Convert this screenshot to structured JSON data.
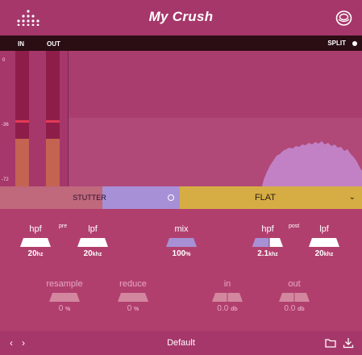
{
  "header": {
    "title": "My Crush",
    "logo_icon": "dots-logo-icon",
    "preset_icon": "preset-menu-icon"
  },
  "meters": {
    "in_label": "IN",
    "out_label": "OUT",
    "scale": [
      "0",
      "-36",
      "-72"
    ],
    "in_level": 0.35,
    "out_level": 0.35,
    "peak_level": 0.47
  },
  "split": {
    "label": "SPLIT"
  },
  "stutter": {
    "label": "STUTTER",
    "selected_fraction": 0.43
  },
  "filter_mode": {
    "label": "FLAT",
    "chevron": "⌄"
  },
  "pre": {
    "tag": "pre",
    "hpf": {
      "label": "hpf",
      "value": "20",
      "unit": "hz"
    },
    "lpf": {
      "label": "lpf",
      "value": "20",
      "unit": "khz"
    }
  },
  "mix": {
    "label": "mix",
    "value": "100",
    "unit": "%"
  },
  "post": {
    "tag": "post",
    "hpf": {
      "label": "hpf",
      "value": "2.1",
      "unit": "khz"
    },
    "lpf": {
      "label": "lpf",
      "value": "20",
      "unit": "khz"
    }
  },
  "resample": {
    "label": "resample",
    "value": "0",
    "unit": "%"
  },
  "reduce": {
    "label": "reduce",
    "value": "0",
    "unit": "%"
  },
  "in_gain": {
    "label": "in",
    "value": "0.0",
    "unit": "db"
  },
  "out_gain": {
    "label": "out",
    "value": "0.0",
    "unit": "db"
  },
  "footer": {
    "prev": "‹",
    "next": "›",
    "preset": "Default",
    "folder_icon": "folder-icon",
    "save_icon": "download-icon"
  },
  "colors": {
    "background": "#b13f6e",
    "stutter": "#a790d6",
    "flat": "#d6ad45",
    "meter_fill": "#c46352",
    "peak": "#e33a55"
  }
}
